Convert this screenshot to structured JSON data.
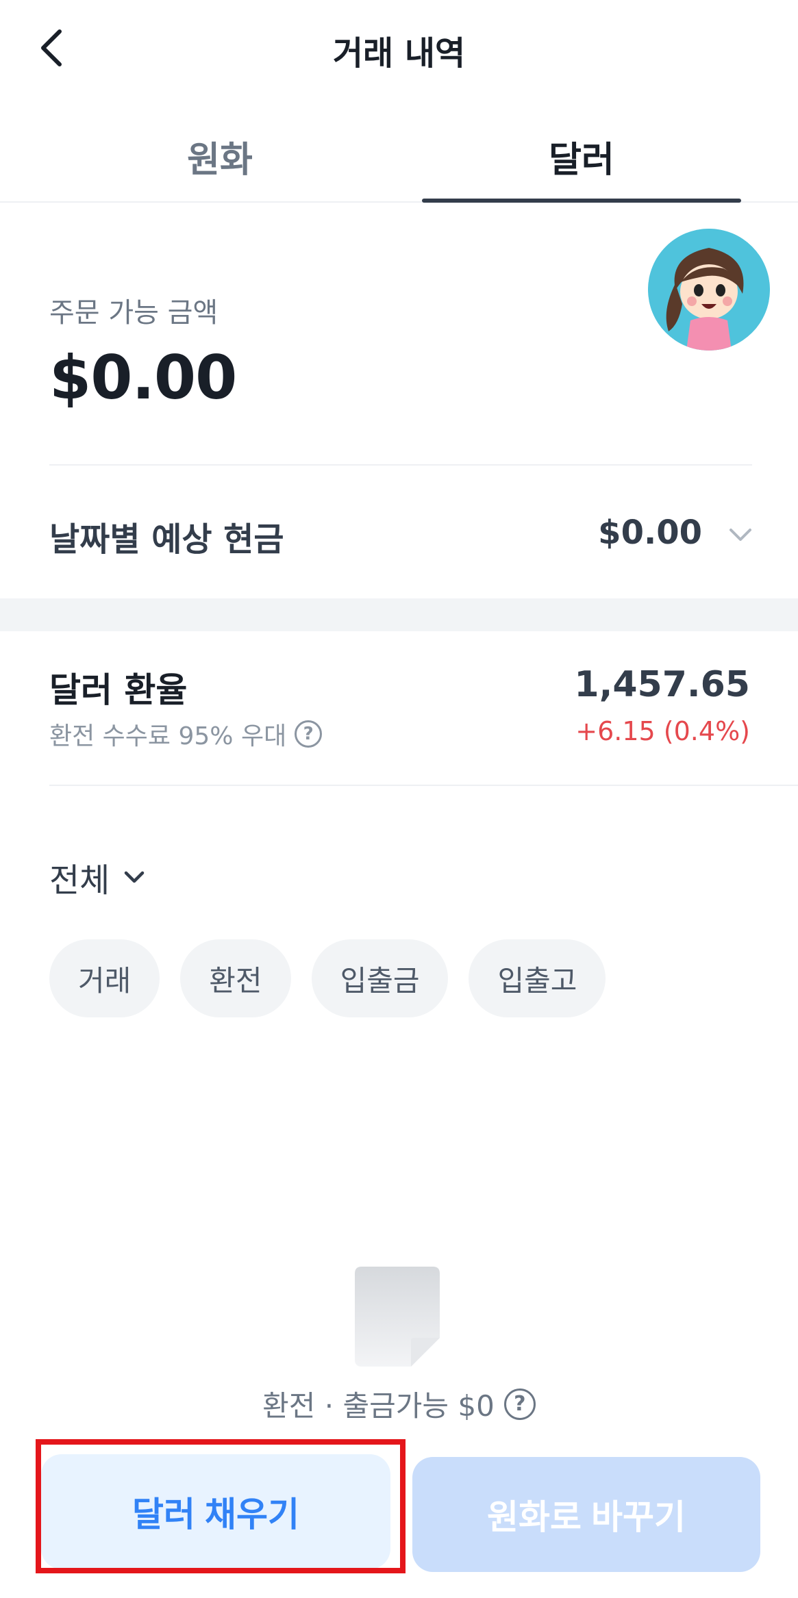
{
  "header": {
    "title": "거래 내역",
    "back_icon": "chevron-left-icon"
  },
  "tabs": [
    {
      "label": "원화",
      "selected": false
    },
    {
      "label": "달러",
      "selected": true
    }
  ],
  "balance": {
    "label": "주문 가능 금액",
    "amount": "$0.00"
  },
  "expected_cash": {
    "label": "날짜별 예상 현금",
    "value": "$0.00",
    "icon": "chevron-down-icon"
  },
  "exchange_rate": {
    "label": "달러 환율",
    "fee_text": "환전 수수료 95% 우대",
    "value": "1,457.65",
    "change": "+6.15 (0.4%)",
    "change_color": "#e5484d"
  },
  "filter": {
    "label": "전체",
    "chips": [
      "거래",
      "환전",
      "입출금",
      "입출고"
    ]
  },
  "empty_state": {
    "text": "환전 · 출금가능 $0"
  },
  "actions": {
    "fill_dollar": "달러 채우기",
    "convert_to_krw": "원화로 바꾸기"
  },
  "colors": {
    "primary": "#3182f6",
    "highlight": "#e4161b",
    "text": "#191f28"
  }
}
